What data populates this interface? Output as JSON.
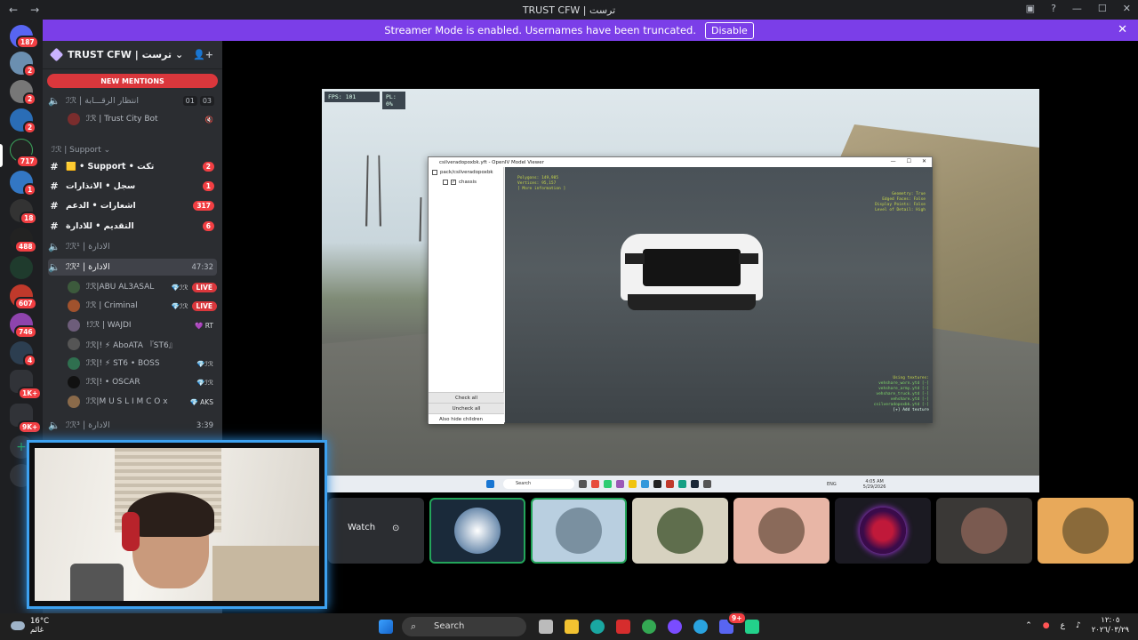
{
  "titlebar": {
    "back": "←",
    "forward": "→",
    "title": "TRUST CFW | ترست",
    "inbox_icon": "inbox-icon",
    "help_icon": "help-icon",
    "minimize": "—",
    "maximize": "☐",
    "close": "✕"
  },
  "banner": {
    "text": "Streamer Mode is enabled. Usernames have been truncated.",
    "button": "Disable",
    "close": "✕"
  },
  "rail": {
    "badges": [
      "187",
      "2",
      "2",
      "2",
      "717",
      "1",
      "18",
      "488",
      "607",
      "746",
      "4",
      "1K+",
      "9K+"
    ],
    "add": "+"
  },
  "server": {
    "name": "TRUST CFW | ترست",
    "chevron": "⌄",
    "invite_icon": "add-member-icon"
  },
  "mentions": "NEW MENTIONS",
  "channels": [
    {
      "icon": "🔈",
      "name": "ℐℛ | انتظار الرقـــابة",
      "pill_a": "01",
      "pill_b": "03"
    },
    {
      "icon": "#",
      "name": "ℐℛ | Support ⌄"
    },
    {
      "icon": "#",
      "name": "🟨 • Support • تكت",
      "count": "2"
    },
    {
      "icon": "#",
      "name": "سجل • الانذارات",
      "count": "1"
    },
    {
      "icon": "#",
      "name": "اشعارات • الدعم",
      "count": "317"
    },
    {
      "icon": "#",
      "name": "التقديم • للادارة",
      "count": "6"
    },
    {
      "icon": "🔈",
      "name": "ℐℛ¹ | الادارة"
    },
    {
      "icon": "🔈",
      "name": "ℐℛ² | الادارة",
      "time": "47:32"
    },
    {
      "icon": "🔈",
      "name": "ℐℛ³ | الادارة",
      "time": "3:39"
    }
  ],
  "bot_member": {
    "name": "ℐℛ | Trust City Bot"
  },
  "voice_members": [
    {
      "name": "ℐℛ|ABU AL3ASAL",
      "tag": "💎ℐℛ",
      "live": "LIVE"
    },
    {
      "name": "ℐℛ | Criminal",
      "tag": "💎ℐℛ",
      "live": "LIVE"
    },
    {
      "name": "!ℐℛ | WAJDI",
      "tag": "💜 RT"
    },
    {
      "name": "ℐℛ|! ⚡ AboATA 『ST6』",
      "tag": ""
    },
    {
      "name": "ℐℛ|! ⚡ ST6 • BOSS",
      "tag": "💎ℐℛ"
    },
    {
      "name": "ℐℛ|! • OSCAR",
      "tag": "💎ℐℛ"
    },
    {
      "name": "ℐℛ|M U S L I M C O x",
      "tag": "💎 AKS"
    }
  ],
  "game": {
    "fps": "FPS: 101",
    "pl": "PL: 0%"
  },
  "viewer": {
    "title": "csilveradopoxbk.yft - OpenIV Model Viewer",
    "path": "pack/csilveradopoxbk",
    "node": "chassis",
    "check_all": "Check all",
    "uncheck_all": "Uncheck all",
    "hide_children": "Also hide children",
    "info_left": [
      "Polygons: 149,985",
      "Vertices: 95,157",
      "[ More information ]"
    ],
    "info_right": [
      "Geometry: True",
      "Edged Faces: False",
      "Display Points: False",
      "Level of Detail: High"
    ],
    "textures_title": "Using textures:",
    "textures": [
      "vehshare_worn.ytd [-]",
      "vehshare_army.ytd [-]",
      "vehshare_truck.ytd [-]",
      "vehshare.ytd [-]",
      "csilveradopoxbk.ytd [-]",
      "[+] Add texture"
    ]
  },
  "stream_taskbar": {
    "search": "Search",
    "time": "4:05 AM",
    "date": "5/29/2026",
    "lang": "ENG"
  },
  "watch": {
    "label": "Watch",
    "icon": "screen-share-icon"
  },
  "taskbar": {
    "temp": "16°C",
    "condition": "غائم",
    "search": "Search",
    "lang": "ع",
    "time": "١٢:٠٥",
    "date": "٢٠٢٦/٠٣/٢٩",
    "discord_badge": "9+"
  }
}
